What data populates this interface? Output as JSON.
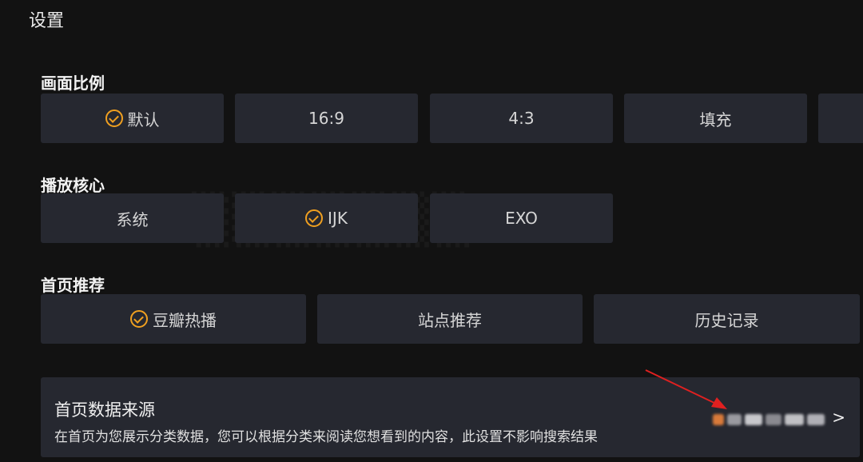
{
  "page": {
    "title": "设置"
  },
  "aspect_ratio": {
    "title": "画面比例",
    "options": [
      {
        "label": "默认",
        "selected": true
      },
      {
        "label": "16:9",
        "selected": false
      },
      {
        "label": "4:3",
        "selected": false
      },
      {
        "label": "填充",
        "selected": false
      }
    ]
  },
  "player_core": {
    "title": "播放核心",
    "options": [
      {
        "label": "系统",
        "selected": false
      },
      {
        "label": "IJK",
        "selected": true
      },
      {
        "label": "EXO",
        "selected": false
      }
    ]
  },
  "home_recommend": {
    "title": "首页推荐",
    "options": [
      {
        "label": "豆瓣热播",
        "selected": true
      },
      {
        "label": "站点推荐",
        "selected": false
      },
      {
        "label": "历史记录",
        "selected": false
      }
    ]
  },
  "home_source": {
    "title": "首页数据来源",
    "description": "在首页为您展示分类数据，您可以根据分类来阅读您想看到的内容，此设置不影响搜索结果",
    "chevron": ">"
  },
  "colors": {
    "accent": "#f0a020",
    "card": "#262830",
    "background": "#121212",
    "annotation": "#e02020"
  }
}
